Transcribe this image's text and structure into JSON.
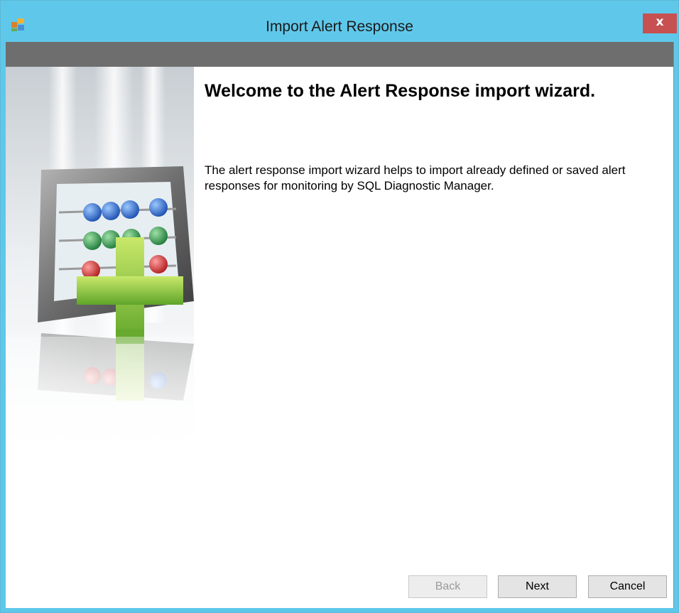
{
  "window": {
    "title": "Import Alert Response",
    "close_label": "x"
  },
  "welcome": {
    "title": "Welcome to the Alert Response import wizard.",
    "description": "The alert response import wizard helps to import already defined or saved alert responses for monitoring by SQL Diagnostic Manager."
  },
  "buttons": {
    "back": "Back",
    "next": "Next",
    "cancel": "Cancel"
  },
  "colors": {
    "titlebar": "#5fc8ea",
    "close": "#c75050",
    "header_band": "#6e6e6e"
  },
  "icons": {
    "app": "app-window-icon",
    "illustration": "abacus-plus-illustration"
  }
}
